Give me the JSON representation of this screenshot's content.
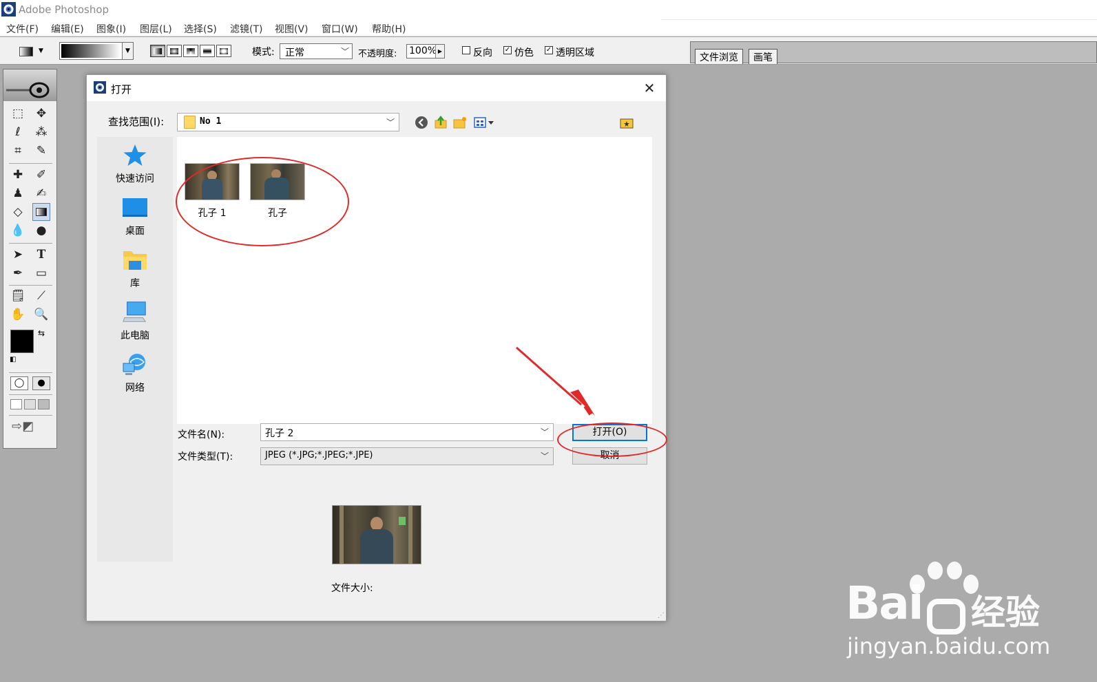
{
  "app": {
    "title": "Adobe Photoshop",
    "icon": "photoshop-eye-icon"
  },
  "menu": [
    {
      "label": "文件(F)"
    },
    {
      "label": "编辑(E)"
    },
    {
      "label": "图象(I)"
    },
    {
      "label": "图层(L)"
    },
    {
      "label": "选择(S)"
    },
    {
      "label": "滤镜(T)"
    },
    {
      "label": "视图(V)"
    },
    {
      "label": "窗口(W)"
    },
    {
      "label": "帮助(H)"
    }
  ],
  "options": {
    "mode_label": "模式:",
    "mode_value": "正常",
    "opacity_label": "不透明度:",
    "opacity_value": "100%",
    "reverse_label": "反向",
    "reverse_checked": false,
    "dither_label": "仿色",
    "dither_checked": true,
    "transparency_label": "透明区域",
    "transparency_checked": true
  },
  "palette_tabs": [
    {
      "label": "文件浏览"
    },
    {
      "label": "画笔"
    }
  ],
  "dialog": {
    "title": "打开",
    "close_glyph": "✕",
    "look_in_label": "查找范围(I):",
    "look_in_value": "No 1",
    "places": [
      {
        "label": "快速访问",
        "icon": "star-icon"
      },
      {
        "label": "桌面",
        "icon": "desktop-icon"
      },
      {
        "label": "库",
        "icon": "library-folder-icon"
      },
      {
        "label": "此电脑",
        "icon": "computer-icon"
      },
      {
        "label": "网络",
        "icon": "network-icon"
      }
    ],
    "files": [
      {
        "label": "孔子 1"
      },
      {
        "label": "孔子"
      }
    ],
    "filename_label": "文件名(N):",
    "filename_value": "孔子 2",
    "filetype_label": "文件类型(T):",
    "filetype_value": "JPEG (*.JPG;*.JPEG;*.JPE)",
    "open_button": "打开(O)",
    "cancel_button": "取消",
    "filesize_label": "文件大小:"
  },
  "colors": {
    "annotation": "#e02a2a",
    "default_button_border": "#0078d7",
    "workspace": "#ababab"
  },
  "watermark": {
    "brand": "Bai",
    "brand_suffix": "经验",
    "url": "jingyan.baidu.com"
  }
}
